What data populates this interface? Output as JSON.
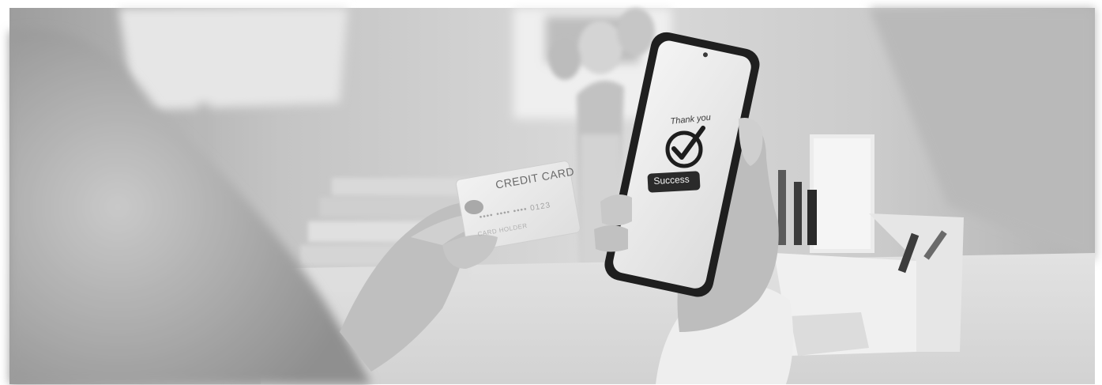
{
  "card": {
    "title": "CREDIT CARD",
    "number": "•••• •••• •••• 0123",
    "name": "CARD HOLDER"
  },
  "phone": {
    "thanks": "Thank you",
    "button_label": "Success",
    "status_icon": "check-circle-icon"
  },
  "colors": {
    "paper": "#ececec",
    "screen": "#efefef",
    "phone_body": "#1f1f1f",
    "badge": "#2a2a2a"
  }
}
